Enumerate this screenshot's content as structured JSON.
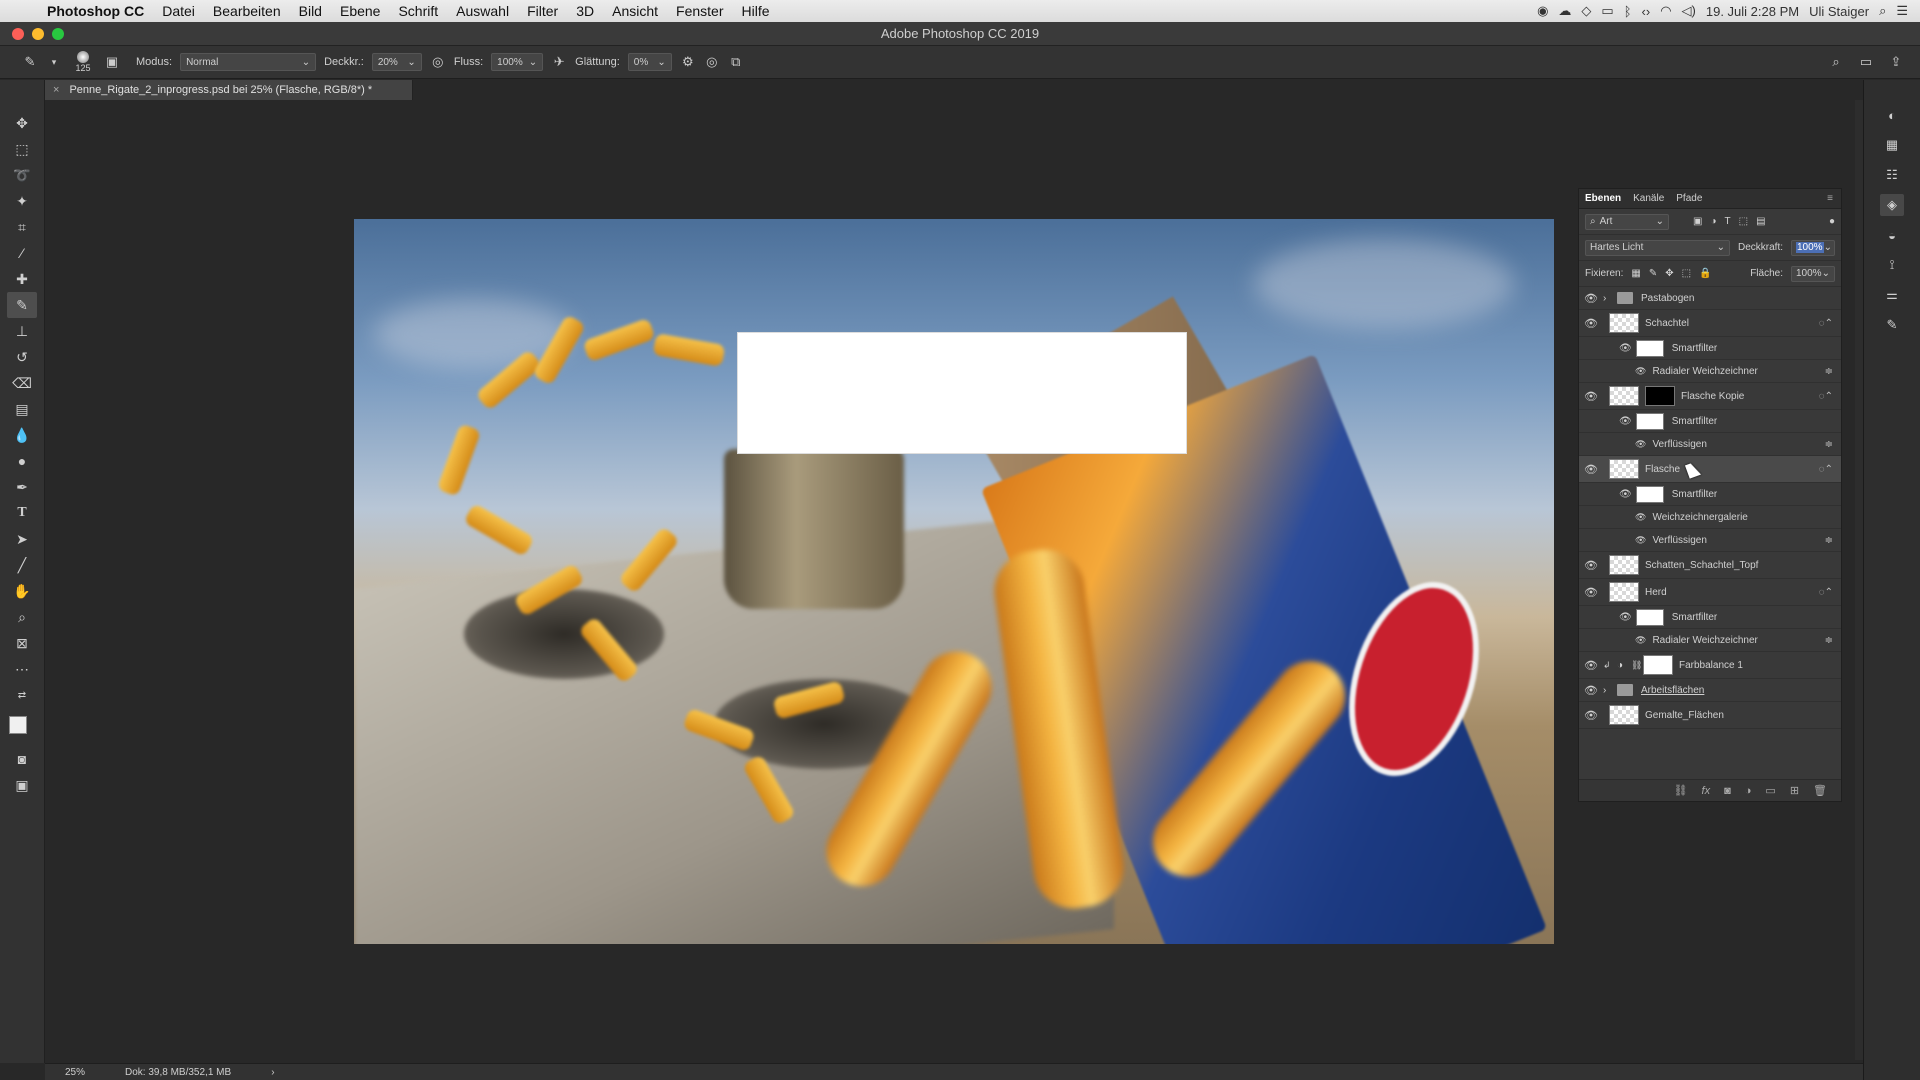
{
  "menubar": {
    "app": "Photoshop CC",
    "items": [
      "Datei",
      "Bearbeiten",
      "Bild",
      "Ebene",
      "Schrift",
      "Auswahl",
      "Filter",
      "3D",
      "Ansicht",
      "Fenster",
      "Hilfe"
    ],
    "clock": "19. Juli  2:28 PM",
    "user": "Uli Staiger"
  },
  "window": {
    "title": "Adobe Photoshop CC 2019"
  },
  "options": {
    "brush_size": "125",
    "mode_label": "Modus:",
    "mode_value": "Normal",
    "opacity_label": "Deckkr.:",
    "opacity_value": "20%",
    "flow_label": "Fluss:",
    "flow_value": "100%",
    "smoothing_label": "Glättung:",
    "smoothing_value": "0%"
  },
  "document": {
    "tab_title": "Penne_Rigate_2_inprogress.psd bei 25% (Flasche, RGB/8*) *"
  },
  "status": {
    "zoom": "25%",
    "doc_size": "Dok: 39,8 MB/352,1 MB"
  },
  "layers_panel": {
    "tabs": [
      "Ebenen",
      "Kanäle",
      "Pfade"
    ],
    "filter_kind": "Art",
    "blend_mode": "Hartes Licht",
    "opacity_label": "Deckkraft:",
    "opacity_value": "100%",
    "lock_label": "Fixieren:",
    "fill_label": "Fläche:",
    "fill_value": "100%",
    "rows": {
      "pastabogen": "Pastabogen",
      "schachtel": "Schachtel",
      "schachtel_sf": "Smartfilter",
      "schachtel_f1": "Radialer Weichzeichner",
      "flasche_kopie": "Flasche Kopie",
      "flasche_kopie_sf": "Smartfilter",
      "flasche_kopie_f1": "Verflüssigen",
      "flasche": "Flasche",
      "flasche_sf": "Smartfilter",
      "flasche_f1": "Weichzeichnergalerie",
      "flasche_f2": "Verflüssigen",
      "schatten": "Schatten_Schachtel_Topf",
      "herd": "Herd",
      "herd_sf": "Smartfilter",
      "herd_f1": "Radialer Weichzeichner",
      "farbbalance": "Farbbalance 1",
      "arbeitsflaechen": "Arbeitsflächen",
      "gemalte": "Gemalte_Flächen"
    }
  },
  "colors": {
    "close": "#fc5f57",
    "minimize": "#fdbc2e",
    "zoom": "#28c840",
    "panel_bg": "#393939",
    "workspace": "#282828"
  }
}
